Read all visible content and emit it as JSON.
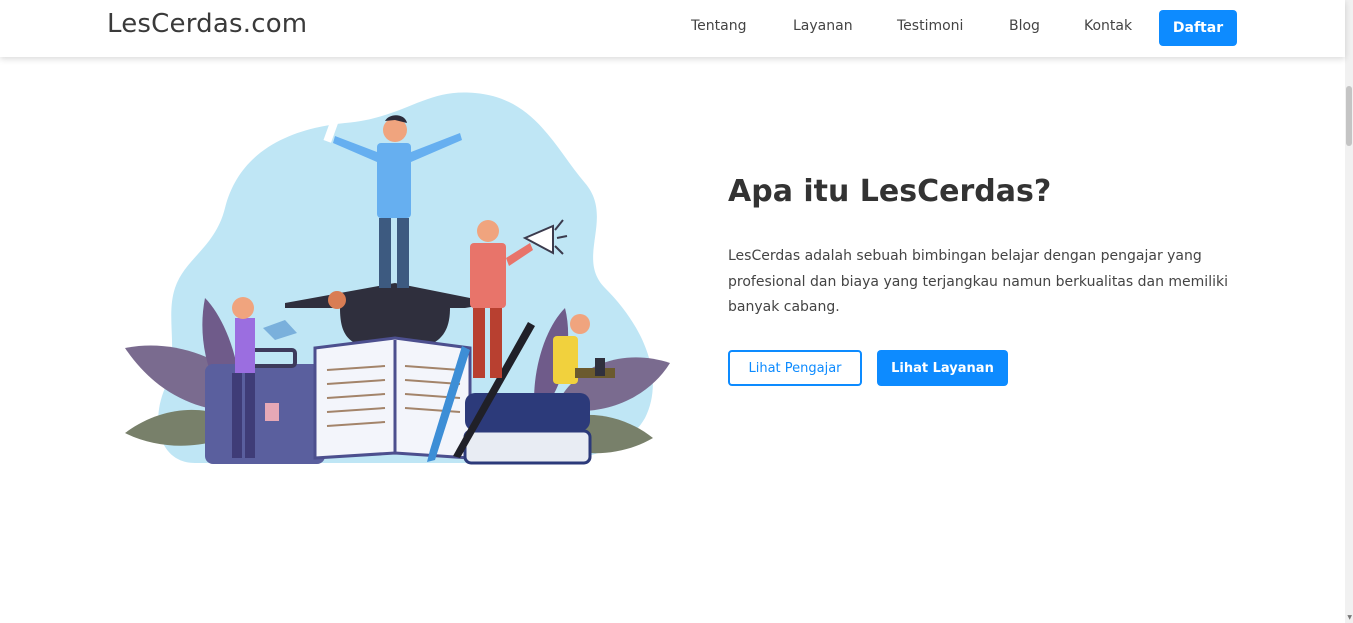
{
  "navbar": {
    "brand": "LesCerdas.com",
    "links": [
      "Tentang",
      "Layanan",
      "Testimoni",
      "Blog",
      "Kontak"
    ],
    "cta": "Daftar"
  },
  "hero": {
    "title": "Apa itu LesCerdas?",
    "description": "LesCerdas adalah sebuah bimbingan belajar dengan pengajar yang profesional dan biaya yang terjangkau namun berkualitas dan memiliki banyak cabang.",
    "buttons": {
      "primary_outline": "Lihat Pengajar",
      "primary_solid": "Lihat Layanan"
    }
  },
  "colors": {
    "accent": "#0d8bff",
    "blob": "#bfe6f5"
  }
}
